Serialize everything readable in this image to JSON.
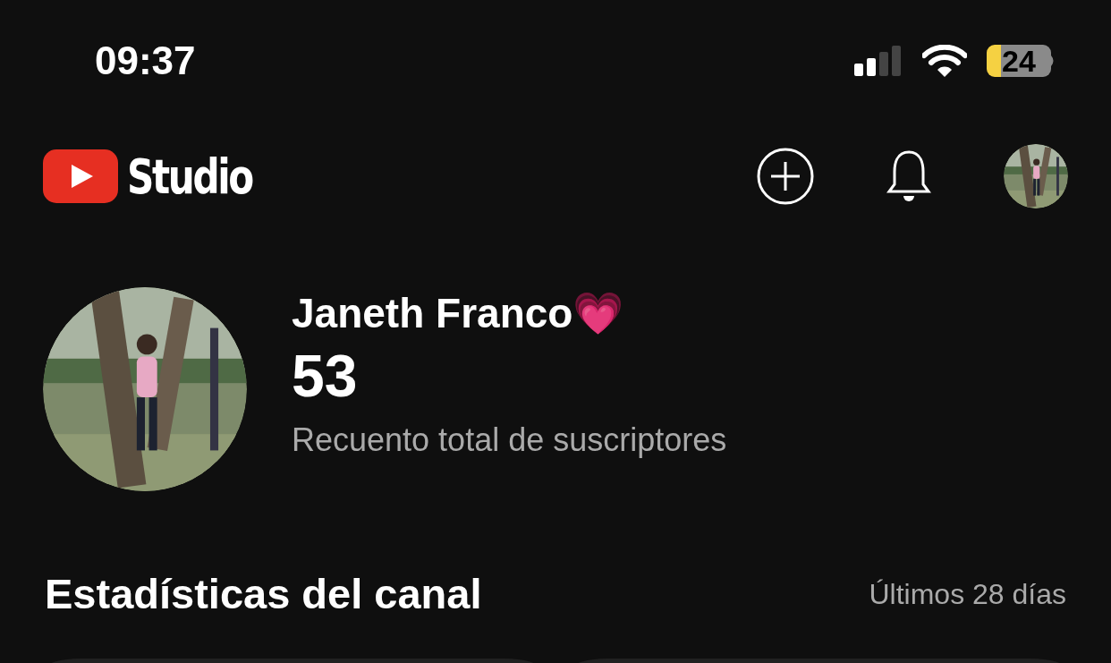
{
  "status_bar": {
    "time": "09:37",
    "battery": "24"
  },
  "header": {
    "logo_text": "Studio"
  },
  "channel": {
    "name": "Janeth Franco💗",
    "subscribers": "53",
    "subscribers_label": "Recuento total de suscriptores"
  },
  "stats": {
    "title": "Estadísticas del canal",
    "period": "Últimos 28 días",
    "cards": [
      {
        "kind": "card"
      },
      {
        "kind": "card"
      }
    ]
  }
}
